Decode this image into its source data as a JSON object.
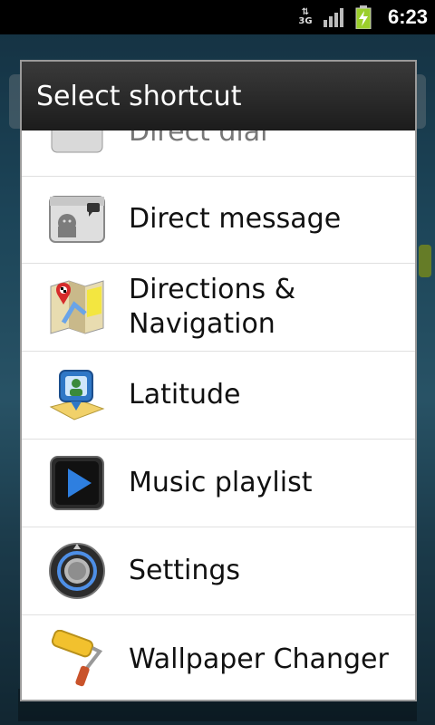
{
  "status_bar": {
    "network_type": "3G",
    "time": "6:23",
    "icons": [
      "data-arrows-icon",
      "signal-bars-icon",
      "battery-charging-icon"
    ]
  },
  "dialog": {
    "title": "Select shortcut",
    "items": [
      {
        "label": "Direct dial",
        "icon": "direct-dial-icon",
        "partially_visible": true
      },
      {
        "label": "Direct message",
        "icon": "direct-message-icon"
      },
      {
        "label": "Directions & Navigation",
        "icon": "navigation-map-icon"
      },
      {
        "label": "Latitude",
        "icon": "latitude-icon"
      },
      {
        "label": "Music playlist",
        "icon": "music-play-icon"
      },
      {
        "label": "Settings",
        "icon": "settings-knob-icon"
      },
      {
        "label": "Wallpaper Changer",
        "icon": "paint-roller-icon"
      }
    ]
  },
  "colors": {
    "dialog_title_bg": "#1c1c1c",
    "list_bg": "#ffffff",
    "status_bar_bg": "#000000",
    "battery_green": "#9bcf2b"
  }
}
